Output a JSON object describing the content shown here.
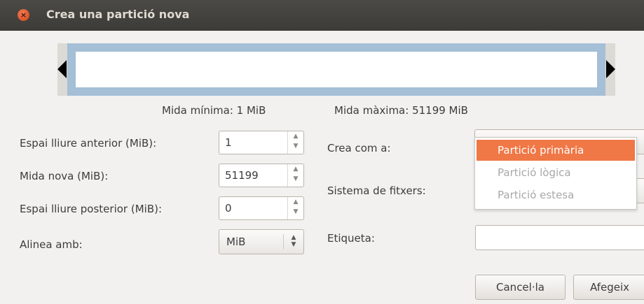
{
  "window": {
    "title": "Crea una partició nova",
    "close_glyph": "×"
  },
  "graph": {
    "left_arrow": "left-arrow",
    "right_arrow": "right-arrow"
  },
  "size_info": {
    "min": "Mida mínima: 1 MiB",
    "max": "Mida màxima: 51199 MiB"
  },
  "fields": {
    "free_before": {
      "label": "Espai lliure anterior (MiB):",
      "value": "1"
    },
    "new_size": {
      "label": "Mida nova (MiB):",
      "value": "51199"
    },
    "free_after": {
      "label": "Espai lliure posterior (MiB):",
      "value": "0"
    },
    "align": {
      "label": "Alinea amb:",
      "value": "MiB"
    }
  },
  "right": {
    "create_as_label": "Crea com a:",
    "filesystem_label": "Sistema de fitxers:",
    "label_label": "Etiqueta:",
    "label_value": ""
  },
  "dropdown": {
    "items": [
      {
        "label": "Partició primària",
        "selected": true
      },
      {
        "label": "Partició lògica",
        "selected": false
      },
      {
        "label": "Partició estesa",
        "selected": false
      }
    ]
  },
  "buttons": {
    "cancel": "Cancel·la",
    "add": "Afegeix"
  },
  "spin_up": "▲",
  "spin_down": "▼",
  "colors": {
    "accent": "#f07746",
    "titlebar": "#3c3b37",
    "graph_border": "#a4bfd6"
  }
}
